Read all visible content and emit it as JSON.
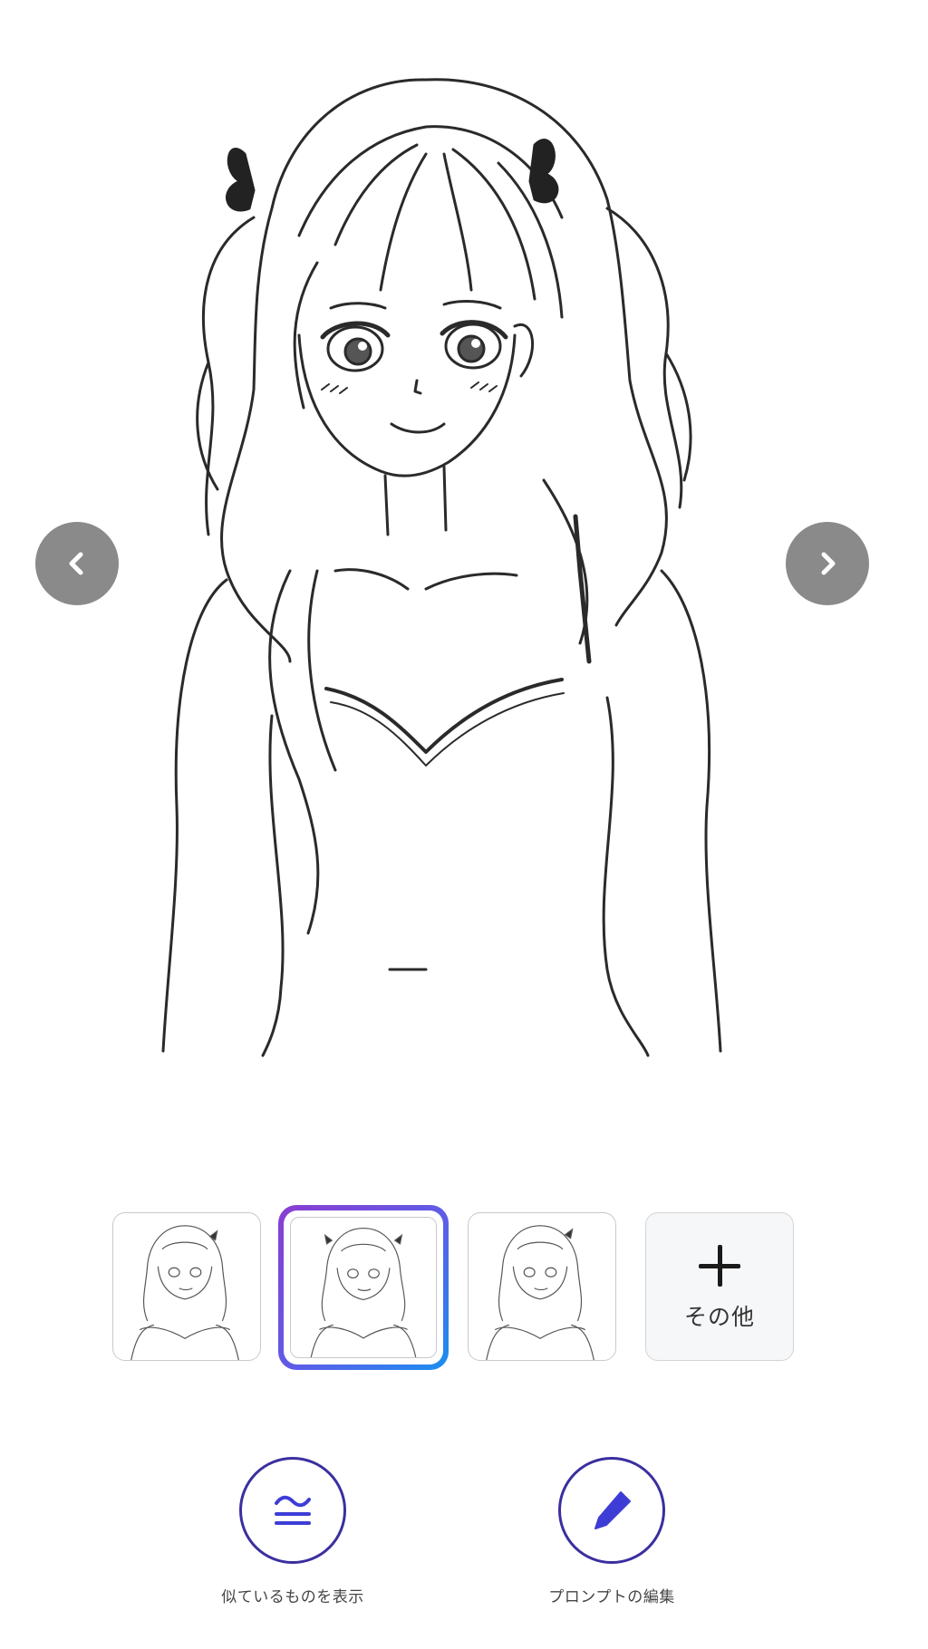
{
  "viewer": {
    "image_description_icon": "anime-girl-line-drawing",
    "prev_icon": "chevron-left-icon",
    "next_icon": "chevron-right-icon",
    "arrow_color": "#8a8a8a"
  },
  "thumbnails": {
    "selected_index": 2,
    "items": [
      {
        "icon": "anime-girl-variant-1"
      },
      {
        "icon": "anime-girl-variant-2"
      },
      {
        "icon": "anime-girl-variant-3"
      }
    ],
    "more": {
      "label": "その他",
      "icon": "plus-icon"
    },
    "selected_gradient": [
      "#8a3dd1",
      "#1b8ff0"
    ]
  },
  "actions": {
    "similar": {
      "label": "似ているものを表示",
      "icon": "approx-equal-icon"
    },
    "edit_prompt": {
      "label": "プロンプトの編集",
      "icon": "pen-icon"
    },
    "accent_color": "#3a2f9f",
    "icon_color": "#3d3dd6"
  }
}
